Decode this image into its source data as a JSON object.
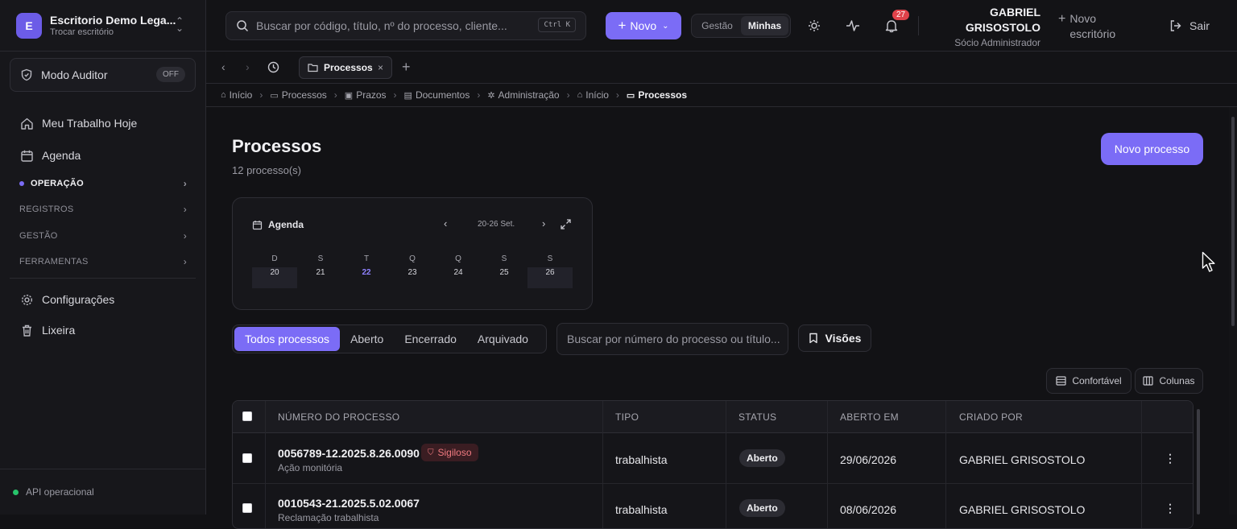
{
  "workspace": {
    "initial": "E",
    "name": "Escritorio Demo Lega...",
    "subtitle": "Trocar escritório"
  },
  "auditor": {
    "label": "Modo Auditor",
    "toggle": "OFF"
  },
  "sidebar": {
    "items": [
      {
        "label": "Meu Trabalho Hoje",
        "icon": "home-icon"
      },
      {
        "label": "Agenda",
        "icon": "calendar-icon"
      }
    ],
    "sections": [
      {
        "label": "OPERAÇÃO",
        "active": true
      },
      {
        "label": "REGISTROS"
      },
      {
        "label": "GESTÃO"
      },
      {
        "label": "FERRAMENTAS"
      }
    ],
    "bottom_items": [
      {
        "label": "Configurações",
        "icon": "gear-icon"
      },
      {
        "label": "Lixeira",
        "icon": "trash-icon"
      }
    ],
    "status": "API operacional"
  },
  "topbar": {
    "search_placeholder": "Buscar por código, título, nº do processo, cliente...",
    "shortcut": "Ctrl K",
    "new_label": "Novo",
    "segment": [
      "Gestão",
      "Minhas"
    ],
    "segment_selected": "Minhas",
    "notifications": "27",
    "user_name_1": "GABRIEL",
    "user_name_2": "GRISOSTOLO",
    "user_role": "Sócio Administrador",
    "new_office_1": "Novo",
    "new_office_2": "escritório",
    "logout": "Sair"
  },
  "tabs": {
    "active": "Processos"
  },
  "breadcrumb": [
    "Início",
    "Processos",
    "Prazos",
    "Documentos",
    "Administração",
    "Início",
    "Processos"
  ],
  "page": {
    "title": "Processos",
    "count": "12 processo(s)",
    "new_button": "Novo processo"
  },
  "calendar": {
    "title": "Agenda",
    "range": "20-26 Set.",
    "weekdays": [
      "D",
      "S",
      "T",
      "Q",
      "Q",
      "S",
      "S"
    ],
    "days": [
      "20",
      "21",
      "22",
      "23",
      "24",
      "25",
      "26"
    ],
    "today": "22"
  },
  "filters": {
    "options": [
      "Todos processos",
      "Aberto",
      "Encerrado",
      "Arquivado"
    ],
    "selected": "Todos processos",
    "search_placeholder": "Buscar por número do processo ou título...",
    "views": "Visões",
    "density": "Confortável",
    "columns": "Colunas"
  },
  "table": {
    "headers": [
      "NÚMERO DO PROCESSO",
      "TIPO",
      "STATUS",
      "ABERTO EM",
      "CRIADO POR"
    ],
    "rows": [
      {
        "number": "0056789-12.2025.8.26.0090",
        "badge": "Sigiloso",
        "subtitle": "Ação monitória",
        "type": "trabalhista",
        "status": "Aberto",
        "opened": "29/06/2026",
        "created_by": "GABRIEL GRISOSTOLO"
      },
      {
        "number": "0010543-21.2025.5.02.0067",
        "badge": "",
        "subtitle": "Reclamação trabalhista",
        "type": "trabalhista",
        "status": "Aberto",
        "opened": "08/06/2026",
        "created_by": "GABRIEL GRISOSTOLO"
      }
    ]
  },
  "colors": {
    "accent": "#7b6cf6",
    "danger": "#e0424a",
    "ok": "#27c46b"
  }
}
